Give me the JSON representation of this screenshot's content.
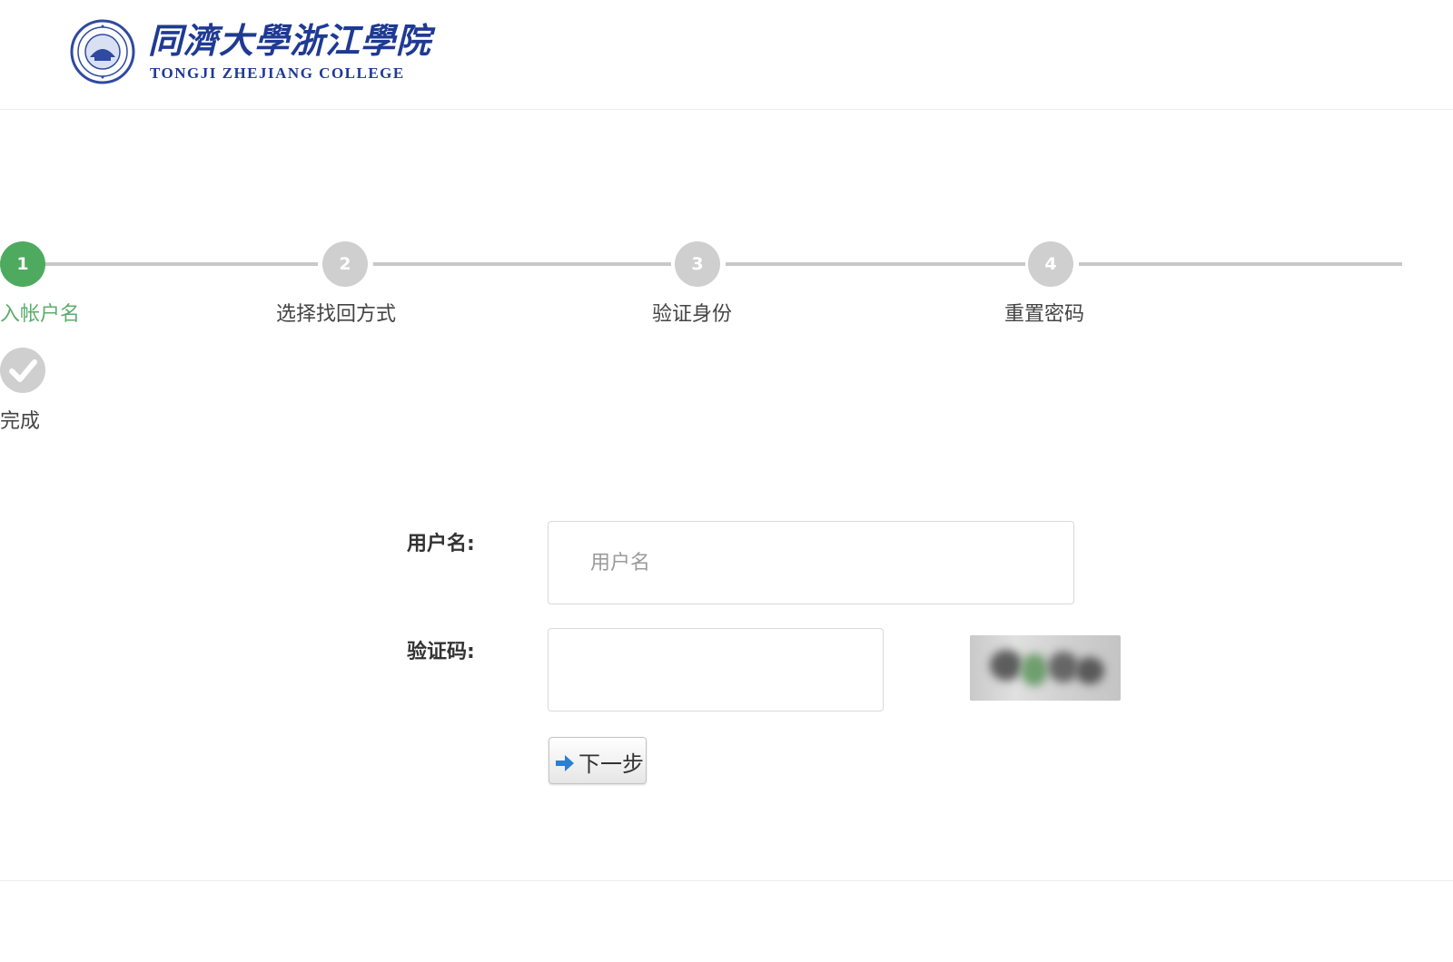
{
  "header": {
    "logo_cn": "同濟大學浙江學院",
    "logo_en": "TONGJI ZHEJIANG COLLEGE"
  },
  "steps": {
    "items": [
      {
        "number": "1",
        "label": "输入帐户名",
        "state": "active"
      },
      {
        "number": "2",
        "label": "选择找回方式",
        "state": "pending"
      },
      {
        "number": "3",
        "label": "验证身份",
        "state": "pending"
      },
      {
        "number": "4",
        "label": "重置密码",
        "state": "pending"
      },
      {
        "number": "",
        "label": "完成",
        "state": "pending",
        "icon": "check-icon"
      }
    ],
    "active_color": "#4eaa5f",
    "inactive_color": "#cfcfcf"
  },
  "form": {
    "username_label": "用户名:",
    "username_placeholder": "用户名",
    "username_value": "",
    "captcha_label": "验证码:",
    "captcha_value": "",
    "next_button": "下一步",
    "next_icon": "arrow-right-icon"
  }
}
